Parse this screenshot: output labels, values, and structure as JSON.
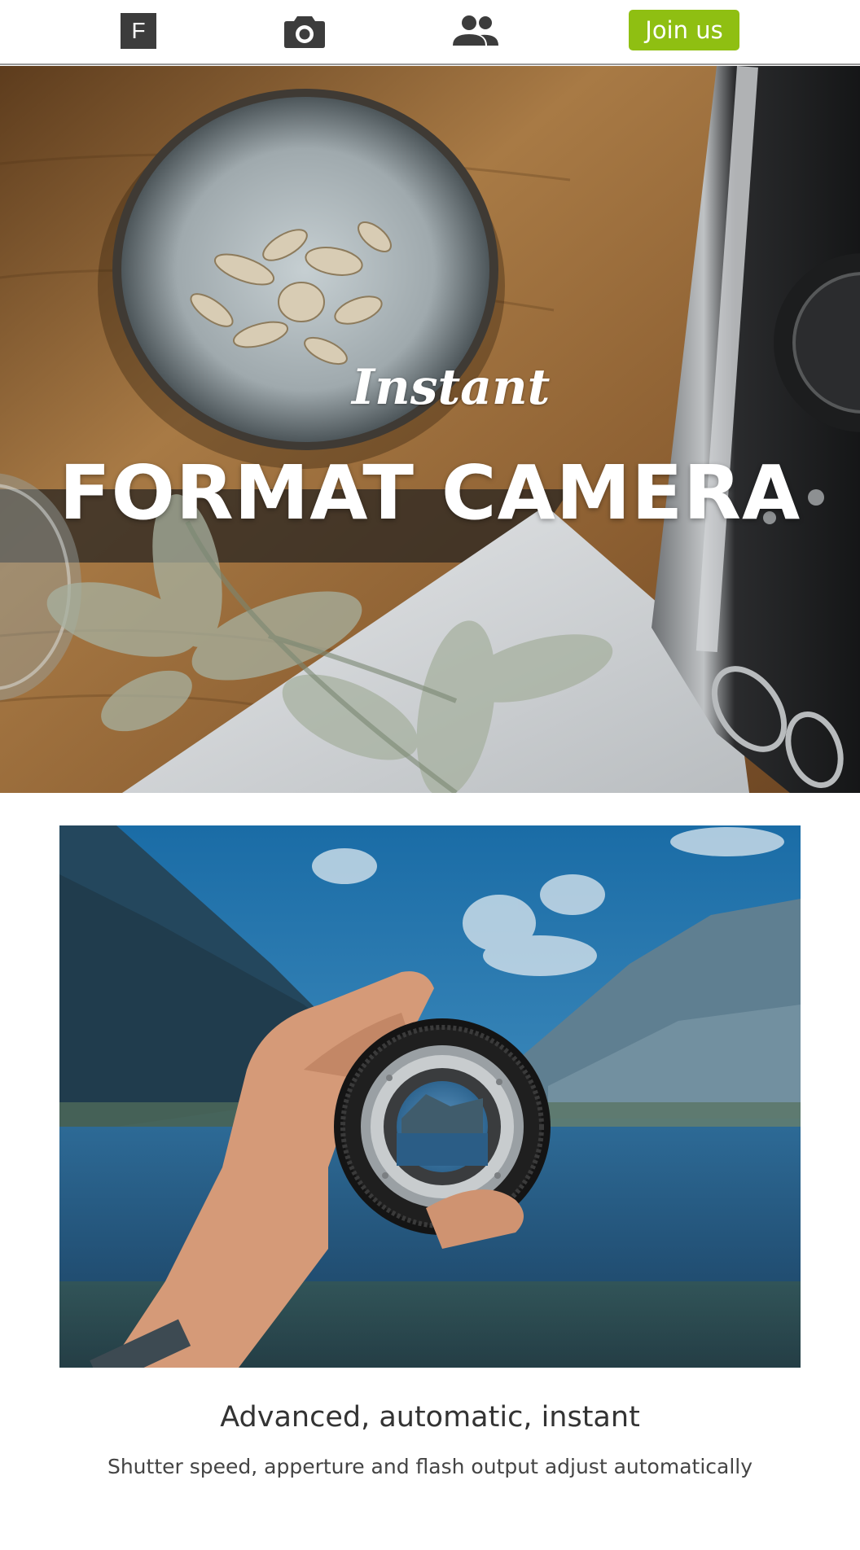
{
  "nav": {
    "logo_letter": "F",
    "items": [
      {
        "icon": "logo-icon"
      },
      {
        "icon": "camera-icon"
      },
      {
        "icon": "people-icon"
      }
    ],
    "join_label": "Join us"
  },
  "hero": {
    "script": "Instant",
    "title": "FORMAT CAMERA"
  },
  "feature": {
    "title": "Advanced, automatic, instant",
    "subtitle": "Shutter speed, apperture and flash output adjust automatically"
  },
  "colors": {
    "accent": "#8fbf12",
    "nav_icon": "#3c3c3c",
    "nav_border": "#9a9a9a",
    "heading_text": "#333333",
    "body_text": "#444444"
  }
}
